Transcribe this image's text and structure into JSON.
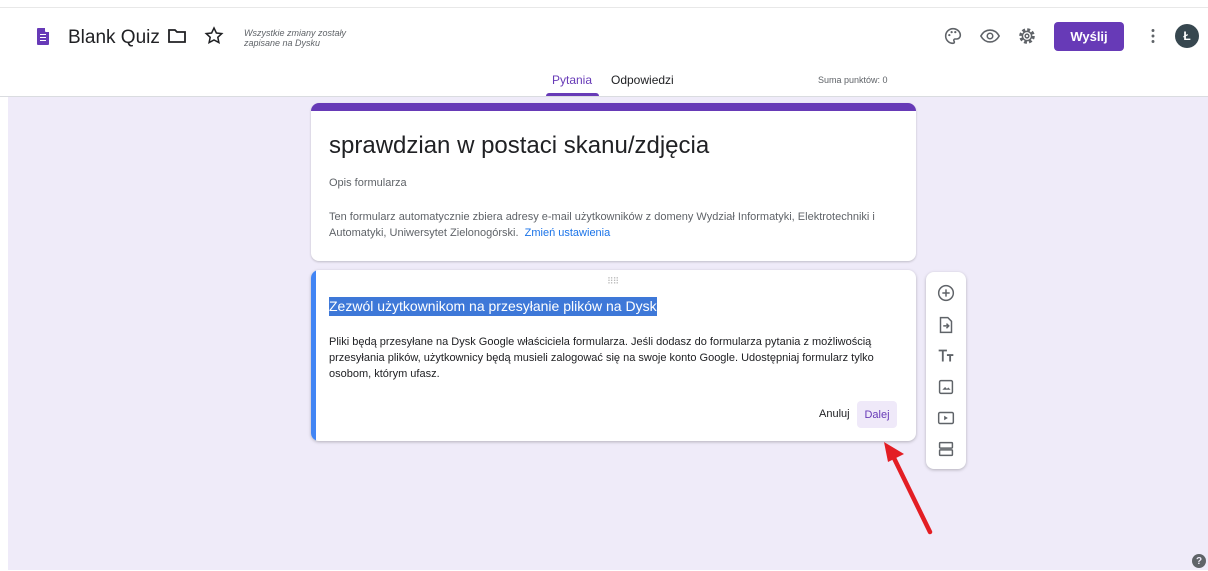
{
  "header": {
    "app_title": "Blank Quiz",
    "save_status": "Wszystkie zmiany zostały zapisane na Dysku",
    "send_label": "Wyślij",
    "avatar_initial": "Ł",
    "icons": [
      "forms-icon",
      "folder-icon",
      "star-icon",
      "palette-icon",
      "eye-icon",
      "gear-icon",
      "more-vert-icon"
    ]
  },
  "tabs": [
    {
      "label": "Pytania",
      "active": true
    },
    {
      "label": "Odpowiedzi",
      "active": false
    }
  ],
  "points_total": "Suma punktów: 0",
  "form": {
    "title": "sprawdzian w postaci skanu/zdjęcia",
    "description_placeholder": "Opis formularza",
    "email_notice": "Ten formularz automatycznie zbiera adresy e-mail użytkowników z domeny Wydział Informatyki, Elektrotechniki i Automatyki, Uniwersytet Zielonogórski.",
    "change_settings_link": "Zmień ustawienia"
  },
  "upload_dialog": {
    "title": "Zezwól użytkownikom na przesyłanie plików na Dysk",
    "text": "Pliki będą przesyłane na Dysk Google właściciela formularza. Jeśli dodasz do formularza pytania z możliwością przesyłania plików, użytkownicy będą musieli zalogować się na swoje konto Google. Udostępniaj formularz tylko osobom, którym ufasz.",
    "cancel_label": "Anuluj",
    "next_label": "Dalej"
  },
  "side_toolbar": [
    "add-question-icon",
    "import-questions-icon",
    "add-title-icon",
    "add-image-icon",
    "add-video-icon",
    "add-section-icon"
  ],
  "colors": {
    "accent": "#673ab7",
    "background": "#efebf9",
    "card_focus": "#4285f4",
    "arrow": "#e31e24"
  }
}
